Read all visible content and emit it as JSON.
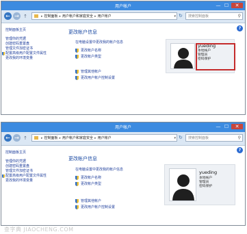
{
  "window": {
    "title": "用户帐户"
  },
  "address": {
    "crumbs": [
      "控制面板",
      "用户帐户和家庭安全",
      "用户帐户"
    ],
    "separator": "▸",
    "dropdown": "▾"
  },
  "search": {
    "placeholder": "搜索控制面板"
  },
  "sidebar": {
    "home": "控制面板主页",
    "items": [
      "管理你的凭据",
      "创建密码重置盘",
      "管理文件加密证书",
      "配置高级用户配置文件属性",
      "更改我的环境变量"
    ],
    "shield_item_index": 3
  },
  "main": {
    "heading": "更改帐户信息",
    "intro": "在电脑设置中更改我的帐户信息",
    "actions_primary": [
      "更改帐户名称",
      "更改帐户类型"
    ],
    "actions_secondary": [
      "管理其他帐户",
      "更改用户帐户控制设置"
    ]
  },
  "account": {
    "username": "yueding",
    "lines": [
      "本地帐户",
      "管理员",
      "密码保护"
    ]
  },
  "highlight": {
    "color": "#c42a2a"
  },
  "watermark": "查字典 JIAOCHENG.COM",
  "icons": {
    "back": "←",
    "forward": "→",
    "up": "↑",
    "refresh": "↻",
    "search": "⚲",
    "help": "?",
    "minimize": "—",
    "maximize": "☐",
    "close": "✕"
  }
}
